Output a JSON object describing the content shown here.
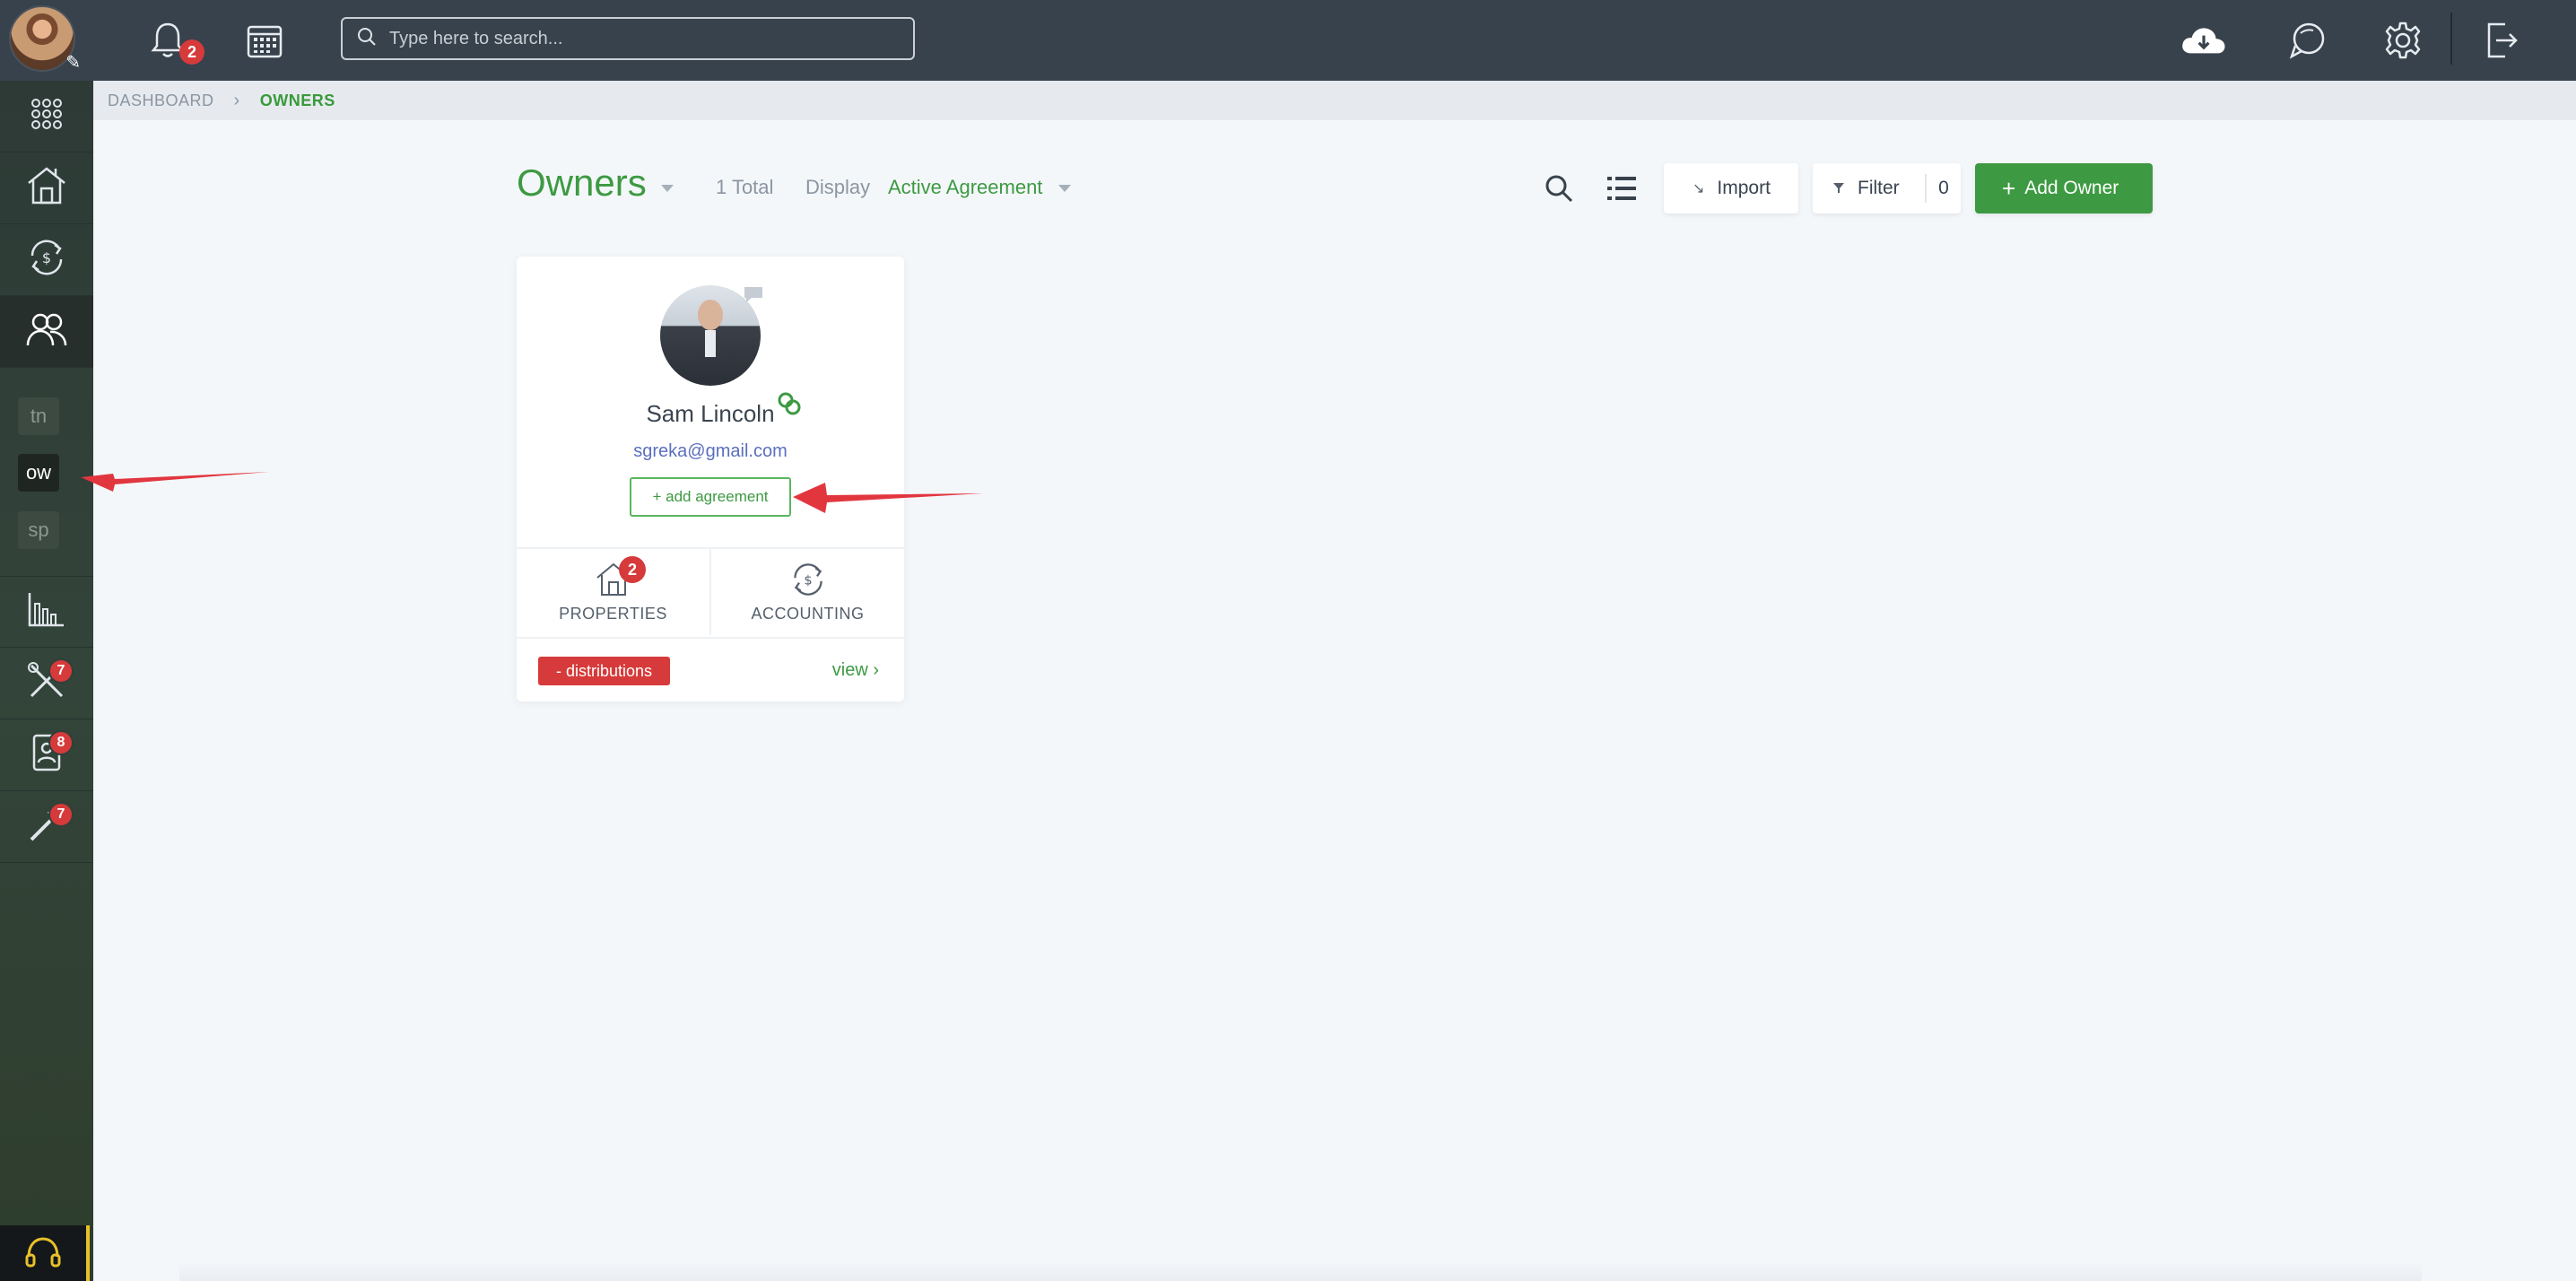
{
  "topbar": {
    "notifications_count": "2",
    "search_placeholder": "Type here to search..."
  },
  "sidebar": {
    "small_items": [
      {
        "label": "tn"
      },
      {
        "label": "ow"
      },
      {
        "label": "sp"
      }
    ],
    "maintenance_badge": "7",
    "applications_badge": "8",
    "tools_badge": "7"
  },
  "breadcrumb": {
    "home": "DASHBOARD",
    "current": "OWNERS"
  },
  "header": {
    "title": "Owners",
    "total": "1 Total",
    "display_label": "Display",
    "display_value": "Active Agreement",
    "import_label": "Import",
    "filter_label": "Filter",
    "filter_count": "0",
    "add_owner_label": "Add Owner"
  },
  "owner_card": {
    "name": "Sam Lincoln",
    "email": "sgreka@gmail.com",
    "add_agreement_label": "+ add agreement",
    "properties_label": "PROPERTIES",
    "properties_count": "2",
    "accounting_label": "ACCOUNTING",
    "distributions_label": "- distributions",
    "view_label": "view"
  },
  "colors": {
    "accent_green": "#3d9a42",
    "badge_red": "#d63a3a",
    "topbar": "#38424c",
    "annotation_arrow": "#e2363f"
  },
  "icons": [
    "bell-icon",
    "calendar-icon",
    "search-icon",
    "cloud-download-icon",
    "chat-icon",
    "gear-icon",
    "logout-icon",
    "apps-grid-icon",
    "properties-icon",
    "accounting-icon",
    "people-icon",
    "reports-icon",
    "maintenance-icon",
    "applications-icon",
    "tools-icon",
    "headset-icon",
    "list-view-icon",
    "link-icon"
  ]
}
